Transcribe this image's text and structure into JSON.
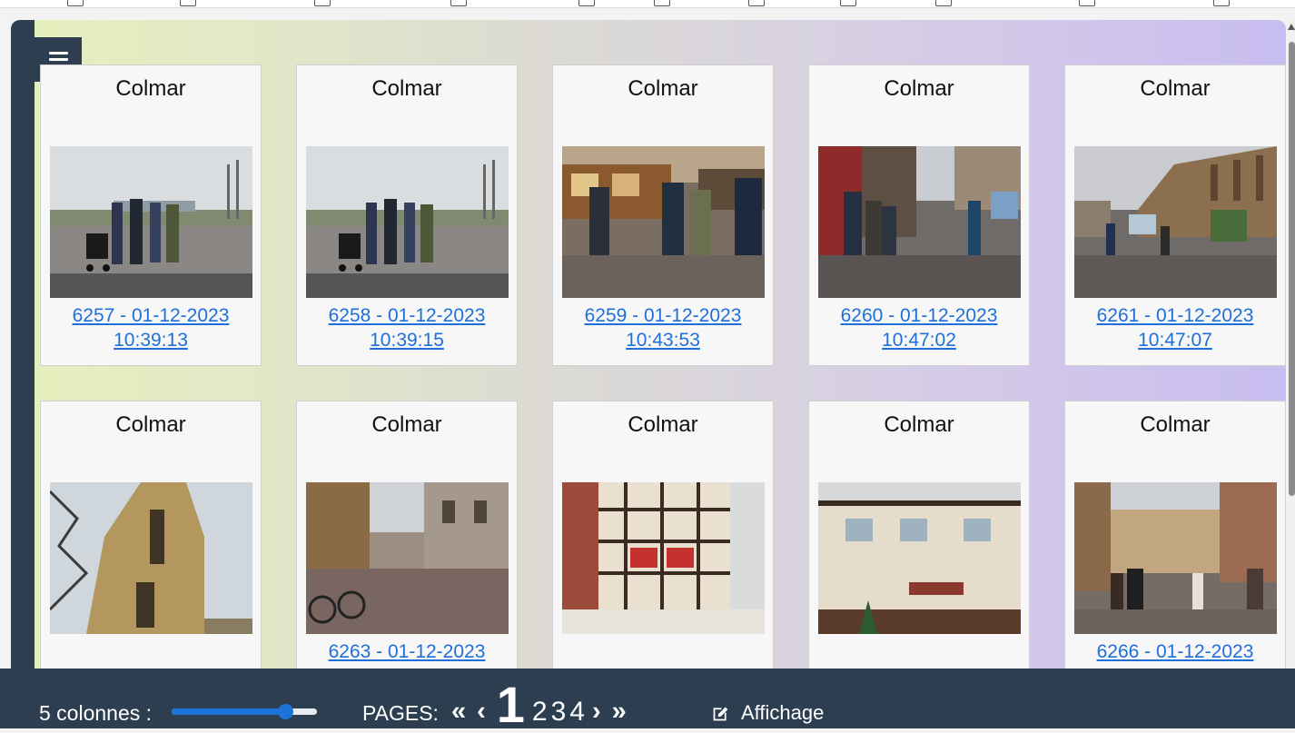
{
  "gallery": {
    "cards": [
      {
        "title": "Colmar",
        "caption_line1": "6257 - 01-12-2023",
        "caption_line2": "10:39:13",
        "photo_icon": "photo-group-square-icon"
      },
      {
        "title": "Colmar",
        "caption_line1": "6258 - 01-12-2023",
        "caption_line2": "10:39:15",
        "photo_icon": "photo-group-square-icon"
      },
      {
        "title": "Colmar",
        "caption_line1": "6259 - 01-12-2023",
        "caption_line2": "10:43:53",
        "photo_icon": "photo-market-icon"
      },
      {
        "title": "Colmar",
        "caption_line1": "6260 - 01-12-2023",
        "caption_line2": "10:47:02",
        "photo_icon": "photo-street-icon"
      },
      {
        "title": "Colmar",
        "caption_line1": "6261 - 01-12-2023",
        "caption_line2": "10:47:07",
        "photo_icon": "photo-church-square-icon"
      },
      {
        "title": "Colmar",
        "caption_line1": "",
        "caption_line2": "",
        "photo_icon": "photo-church-tower-icon"
      },
      {
        "title": "Colmar",
        "caption_line1": "6263 - 01-12-2023",
        "caption_line2": "",
        "photo_icon": "photo-street-bikes-icon"
      },
      {
        "title": "Colmar",
        "caption_line1": "",
        "caption_line2": "",
        "photo_icon": "photo-timber-house-icon"
      },
      {
        "title": "Colmar",
        "caption_line1": "",
        "caption_line2": "",
        "photo_icon": "photo-restaurant-icon"
      },
      {
        "title": "Colmar",
        "caption_line1": "6266 - 01-12-2023",
        "caption_line2": "",
        "photo_icon": "photo-crowd-street-icon"
      }
    ]
  },
  "footer": {
    "columns_label": "5 colonnes :",
    "columns_value": 5,
    "columns_slider_fraction": 0.78,
    "pages_label": "PAGES:",
    "first_symbol": "«",
    "prev_symbol": "‹",
    "current_page": "1",
    "pages": [
      "2",
      "3",
      "4"
    ],
    "next_symbol": "›",
    "last_symbol": "»",
    "display_label": "Affichage",
    "display_icon": "edit-icon"
  },
  "colors": {
    "sidebar": "#2c3e50",
    "link": "#1e6fd9",
    "slider": "#1e73d8"
  }
}
